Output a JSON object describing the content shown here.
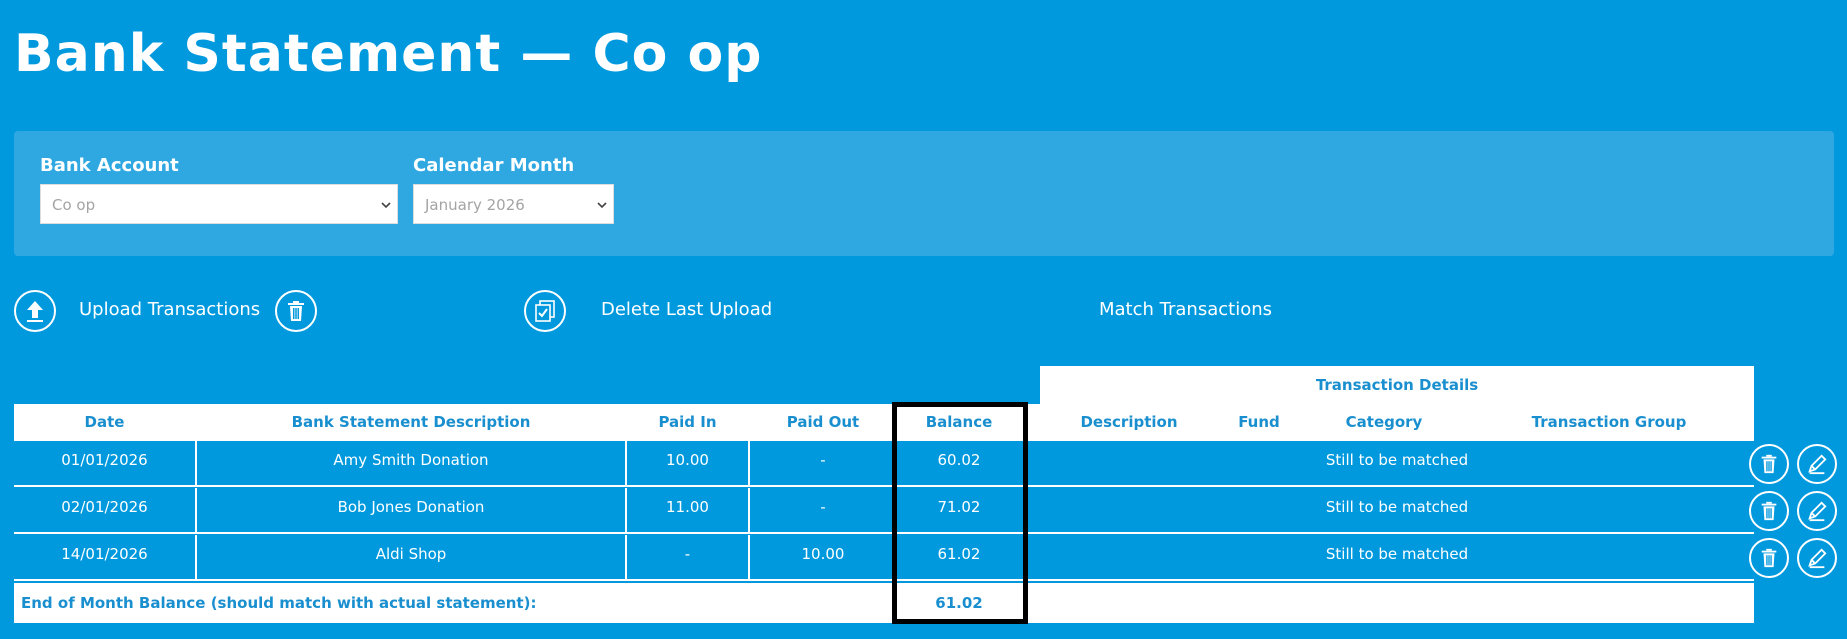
{
  "page": {
    "title": "Bank Statement — Co op"
  },
  "filters": {
    "bank_account": {
      "label": "Bank Account",
      "value": "Co op"
    },
    "calendar_month": {
      "label": "Calendar Month",
      "value": "January 2026"
    }
  },
  "actions": [
    {
      "label": "Upload Transactions",
      "icon": "upload-icon"
    },
    {
      "label": "Delete Last Upload",
      "icon": "trash-icon"
    },
    {
      "label": "Match Transactions",
      "icon": "match-icon"
    }
  ],
  "table": {
    "group_header": "Transaction Details",
    "columns": {
      "date": "Date",
      "description": "Bank Statement Description",
      "paid_in": "Paid In",
      "paid_out": "Paid Out",
      "balance": "Balance",
      "detail_description": "Description",
      "fund": "Fund",
      "category": "Category",
      "transaction_group": "Transaction Group"
    },
    "rows": [
      {
        "date": "01/01/2026",
        "description": "Amy Smith Donation",
        "paid_in": "10.00",
        "paid_out": "-",
        "balance": "60.02",
        "status": "Still to be matched"
      },
      {
        "date": "02/01/2026",
        "description": "Bob Jones Donation",
        "paid_in": "11.00",
        "paid_out": "-",
        "balance": "71.02",
        "status": "Still to be matched"
      },
      {
        "date": "14/01/2026",
        "description": "Aldi Shop",
        "paid_in": "-",
        "paid_out": "10.00",
        "balance": "61.02",
        "status": "Still to be matched"
      }
    ],
    "footer": {
      "label": "End of Month Balance (should match with actual statement):",
      "value": "61.02"
    }
  },
  "colors": {
    "background": "#0099de",
    "panel": "#2fa8e2",
    "header_text": "#1a8fcf",
    "highlight_border": "#000000"
  }
}
